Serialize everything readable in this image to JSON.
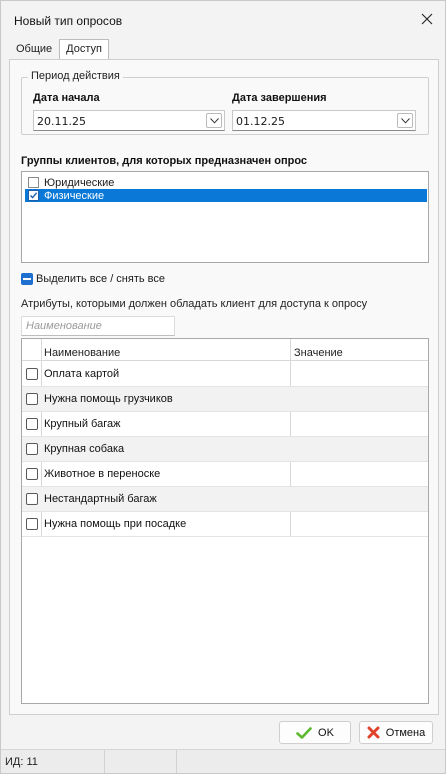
{
  "window": {
    "title": "Новый тип опросов"
  },
  "tabs": [
    {
      "label": "Общие",
      "active": false
    },
    {
      "label": "Доступ",
      "active": true
    }
  ],
  "period": {
    "legend": "Период действия",
    "start_label": "Дата начала",
    "start_value": "20.11.25",
    "end_label": "Дата завершения",
    "end_value": "01.12.25"
  },
  "groups": {
    "title": "Группы клиентов, для которых предназначен опрос",
    "items": [
      {
        "label": "Юридические",
        "checked": false,
        "selected": false
      },
      {
        "label": "Физические",
        "checked": true,
        "selected": true
      }
    ],
    "select_all_label": "Выделить все / снять все"
  },
  "attributes": {
    "caption": "Атрибуты, которыми должен обладать клиент для доступа к опросу",
    "filter_placeholder": "Наименование",
    "columns": [
      "Наименование",
      "Значение"
    ],
    "rows": [
      {
        "name": "Оплата картой",
        "value": "",
        "checked": false
      },
      {
        "name": "Нужна помощь грузчиков",
        "value": "",
        "checked": false
      },
      {
        "name": "Крупный багаж",
        "value": "",
        "checked": false
      },
      {
        "name": "Крупная собака",
        "value": "",
        "checked": false
      },
      {
        "name": "Животное в переноске",
        "value": "",
        "checked": false
      },
      {
        "name": "Нестандартный багаж",
        "value": "",
        "checked": false
      },
      {
        "name": "Нужна помощь при посадке",
        "value": "",
        "checked": false
      }
    ]
  },
  "buttons": {
    "ok_label": "OK",
    "cancel_label": "Отмена"
  },
  "status": {
    "id_text": "ИД: 11"
  },
  "colors": {
    "selection": "#0a78d7",
    "ok_icon": "#5cb82e",
    "cancel_icon": "#e0432b"
  },
  "icons": [
    "close-icon",
    "chevron-down-icon",
    "checkmark-icon",
    "minus-icon",
    "ok-check-icon",
    "cancel-x-icon"
  ]
}
